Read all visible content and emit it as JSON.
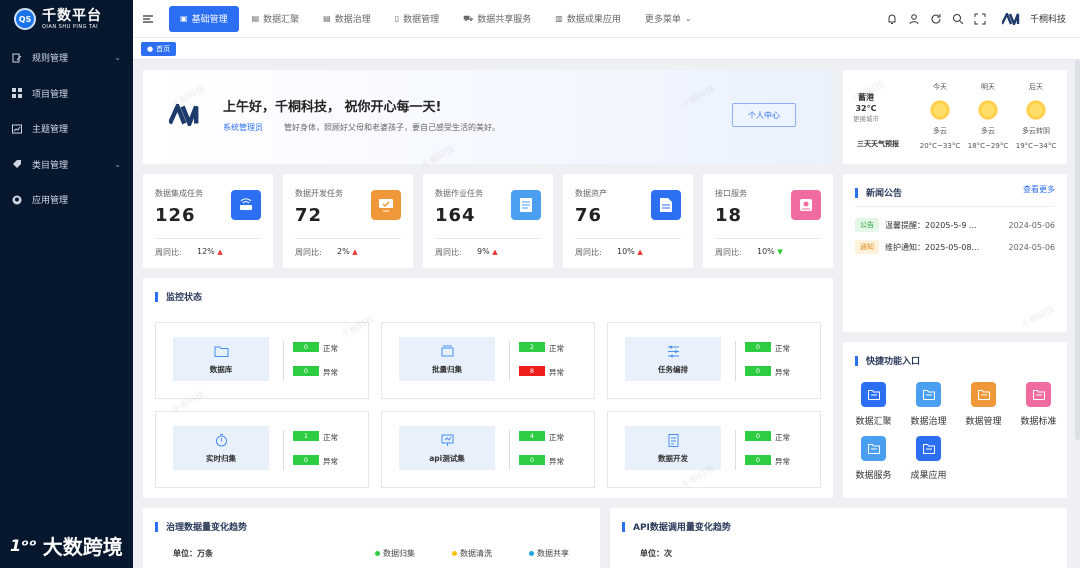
{
  "app": {
    "title": "千数平台",
    "subtitle": "QIAN SHU PING TAI",
    "badge": "QS"
  },
  "sidebar": {
    "items": [
      {
        "label": "规则管理",
        "icon": "document-edit-icon",
        "expandable": true
      },
      {
        "label": "项目管理",
        "icon": "grid-icon",
        "expandable": false
      },
      {
        "label": "主题管理",
        "icon": "chart-icon",
        "expandable": false
      },
      {
        "label": "类目管理",
        "icon": "tag-icon",
        "expandable": true
      },
      {
        "label": "应用管理",
        "icon": "github-icon",
        "expandable": false
      }
    ]
  },
  "topnav": {
    "tabs": [
      {
        "label": "基础管理",
        "active": true
      },
      {
        "label": "数据汇聚"
      },
      {
        "label": "数据治理"
      },
      {
        "label": "数据管理"
      },
      {
        "label": "数据共享服务"
      },
      {
        "label": "数据成果应用"
      },
      {
        "label": "更多菜单"
      }
    ],
    "user_name": "千桐科技"
  },
  "breadcrumb": {
    "home": "首页"
  },
  "welcome": {
    "greeting": "上午好，千桐科技， 祝你开心每一天!",
    "role": "系统管理员",
    "motto": "管好身体，照顾好父母和老婆孩子，要自己感受生活的美好。",
    "center_button": "个人中心"
  },
  "weather": {
    "city": "蓄港",
    "temp": "32°C",
    "change_city": "更换城市",
    "forecast_title": "三天天气预报",
    "days": [
      {
        "name": "今天",
        "desc": "多云",
        "range": "20°C~33°C"
      },
      {
        "name": "明天",
        "desc": "多云",
        "range": "18°C~29°C"
      },
      {
        "name": "后天",
        "desc": "多云转阴",
        "range": "19°C~34°C"
      }
    ]
  },
  "stats": {
    "week_label": "周同比:",
    "items": [
      {
        "label": "数据集成任务",
        "value": "126",
        "pct": "12%",
        "trend": "up",
        "color": "#2d6ff3"
      },
      {
        "label": "数据开发任务",
        "value": "72",
        "pct": "2%",
        "trend": "up",
        "color": "#f0973a"
      },
      {
        "label": "数据作业任务",
        "value": "164",
        "pct": "9%",
        "trend": "up",
        "color": "#4a9ff0"
      },
      {
        "label": "数据资产",
        "value": "76",
        "pct": "10%",
        "trend": "up",
        "color": "#2d6ff3"
      },
      {
        "label": "接口服务",
        "value": "18",
        "pct": "10%",
        "trend": "down",
        "color": "#f06ba0"
      }
    ]
  },
  "monitor": {
    "title": "监控状态",
    "normal_label": "正常",
    "abnormal_label": "异常",
    "items": [
      {
        "name": "数据库",
        "normal": "0",
        "abnormal": "0",
        "abnormal_alert": false
      },
      {
        "name": "批量归集",
        "normal": "2",
        "abnormal": "8",
        "abnormal_alert": true
      },
      {
        "name": "任务编排",
        "normal": "0",
        "abnormal": "0",
        "abnormal_alert": false
      },
      {
        "name": "实时归集",
        "normal": "1",
        "abnormal": "0",
        "abnormal_alert": false
      },
      {
        "name": "api测试集",
        "normal": "4",
        "abnormal": "0",
        "abnormal_alert": false
      },
      {
        "name": "数据开发",
        "normal": "0",
        "abnormal": "0",
        "abnormal_alert": false
      }
    ]
  },
  "news": {
    "title": "新闻公告",
    "more": "查看更多",
    "items": [
      {
        "badge": "公告",
        "text": "温馨提醒：20205-5-9 ...",
        "date": "2024-05-06",
        "type": "notice"
      },
      {
        "badge": "通知",
        "text": "维护通知：2025-05-08...",
        "date": "2024-05-06",
        "type": "inform"
      }
    ]
  },
  "quick": {
    "title": "快捷功能入口",
    "items": [
      {
        "label": "数据汇聚",
        "color": "#2d6ff3"
      },
      {
        "label": "数据治理",
        "color": "#4a9ff0"
      },
      {
        "label": "数据管理",
        "color": "#f0973a"
      },
      {
        "label": "数据标准",
        "color": "#f06ba0"
      },
      {
        "label": "数据服务",
        "color": "#4a9ff0"
      },
      {
        "label": "成果应用",
        "color": "#2d6ff3"
      }
    ]
  },
  "trend_governance": {
    "title": "治理数据量变化趋势",
    "unit": "单位：万条",
    "legend": [
      {
        "label": "数据归集",
        "color": "#2ecc40"
      },
      {
        "label": "数据清洗",
        "color": "#f5c518"
      },
      {
        "label": "数据共享",
        "color": "#1ea7e8"
      }
    ]
  },
  "trend_api": {
    "title": "API数据调用量变化趋势",
    "unit": "单位：次"
  },
  "watermark": {
    "text": "千桐科技",
    "corner_brand": "大数跨境"
  }
}
